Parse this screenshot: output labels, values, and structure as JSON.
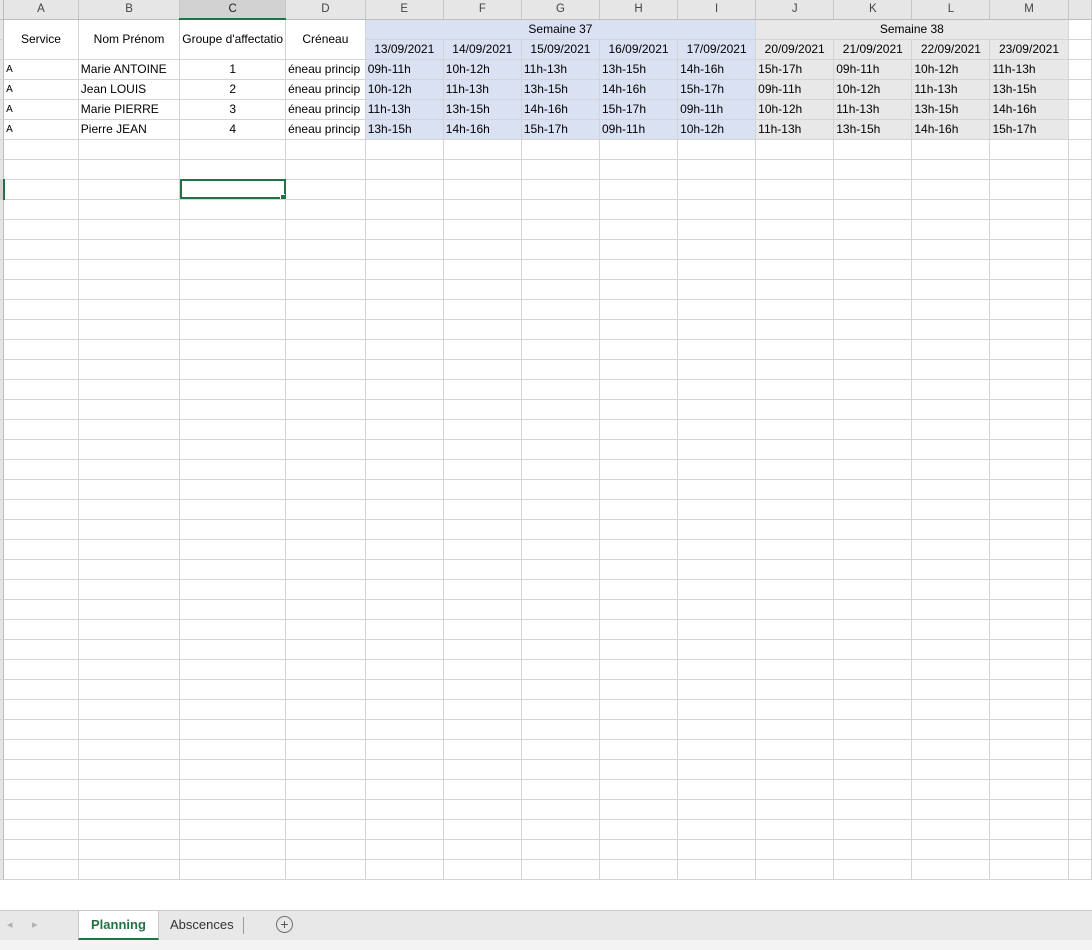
{
  "columns": [
    "A",
    "B",
    "C",
    "D",
    "E",
    "F",
    "G",
    "H",
    "I",
    "J",
    "K",
    "L",
    "M"
  ],
  "headers": {
    "service": "Service",
    "nom": "Nom Prénom",
    "groupe": "Groupe d'affectatio",
    "creneau": "Créneau",
    "week37": "Semaine 37",
    "week38": "Semaine 38"
  },
  "dates": [
    "13/09/2021",
    "14/09/2021",
    "15/09/2021",
    "16/09/2021",
    "17/09/2021",
    "20/09/2021",
    "21/09/2021",
    "22/09/2021",
    "23/09/2021"
  ],
  "rows": [
    {
      "service": "A",
      "name": "Marie ANTOINE",
      "group": "1",
      "creneau": "éneau princip",
      "slots": [
        "09h-11h",
        "10h-12h",
        "11h-13h",
        "13h-15h",
        "14h-16h",
        "15h-17h",
        "09h-11h",
        "10h-12h",
        "11h-13h"
      ]
    },
    {
      "service": "A",
      "name": "Jean LOUIS",
      "group": "2",
      "creneau": "éneau princip",
      "slots": [
        "10h-12h",
        "11h-13h",
        "13h-15h",
        "14h-16h",
        "15h-17h",
        "09h-11h",
        "10h-12h",
        "11h-13h",
        "13h-15h"
      ]
    },
    {
      "service": "A",
      "name": "Marie PIERRE",
      "group": "3",
      "creneau": "éneau princip",
      "slots": [
        "11h-13h",
        "13h-15h",
        "14h-16h",
        "15h-17h",
        "09h-11h",
        "10h-12h",
        "11h-13h",
        "13h-15h",
        "14h-16h"
      ]
    },
    {
      "service": "A",
      "name": "Pierre JEAN",
      "group": "4",
      "creneau": "éneau princip",
      "slots": [
        "13h-15h",
        "14h-16h",
        "15h-17h",
        "09h-11h",
        "10h-12h",
        "11h-13h",
        "13h-15h",
        "14h-16h",
        "15h-17h"
      ]
    }
  ],
  "sheet_tabs": [
    {
      "label": "Planning",
      "active": true
    },
    {
      "label": "Abscences",
      "active": false
    }
  ],
  "icons": {
    "prev": "chevron-left-icon",
    "next": "chevron-right-icon",
    "add": "plus-circle-icon"
  },
  "colors": {
    "week37_fill": "#dae1f3",
    "week38_fill": "#e8e8e8",
    "accent": "#217346"
  }
}
